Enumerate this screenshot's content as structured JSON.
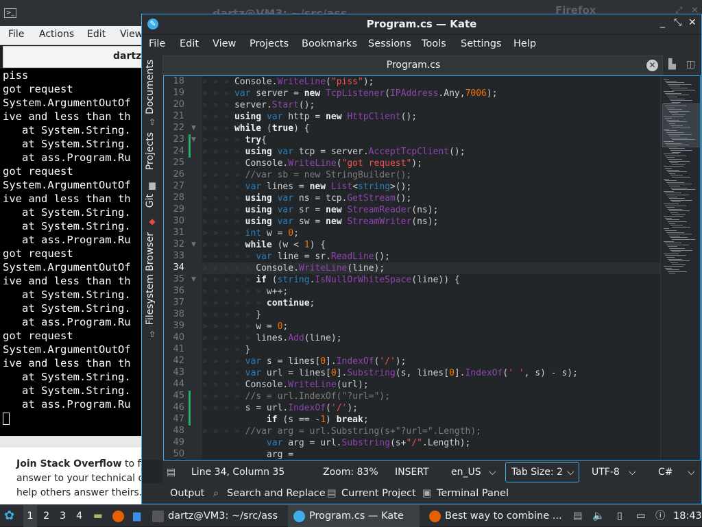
{
  "background_window": {
    "title": "dartz@VM3: ~/src/ass",
    "other_title": "Firefox",
    "menu": [
      "File",
      "Actions",
      "Edit",
      "View"
    ],
    "tab_title": "dartz",
    "terminal_lines": [
      "piss",
      "got request",
      "System.ArgumentOutOf",
      "ive and less than th",
      "   at System.String.",
      "   at System.String.",
      "   at ass.Program.Ru",
      "got request",
      "System.ArgumentOutOf",
      "ive and less than th",
      "   at System.String.",
      "   at System.String.",
      "   at ass.Program.Ru",
      "got request",
      "System.ArgumentOutOf",
      "ive and less than th",
      "   at System.String.",
      "   at System.String.",
      "   at ass.Program.Ru",
      "got request",
      "System.ArgumentOutOf",
      "ive and less than th",
      "   at System.String.",
      "   at System.String.",
      "   at ass.Program.Ru"
    ],
    "stackoverflow": {
      "bold": "Join Stack Overflow",
      "line1": " to fin",
      "line2": "answer to your technical qu",
      "line3": "help others answer theirs."
    }
  },
  "kate": {
    "title": "Program.cs  — Kate",
    "menu": [
      "File",
      "Edit",
      "View",
      "Projects",
      "Bookmarks",
      "Sessions",
      "Tools",
      "Settings",
      "Help"
    ],
    "side_tabs": [
      "Documents",
      "Projects",
      "Git",
      "Filesystem Browser"
    ],
    "tab_name": "Program.cs",
    "current_line": 34,
    "code_lines": [
      {
        "n": 18,
        "d": 3,
        "t": "Console.WriteLine(\"piss\");"
      },
      {
        "n": 19,
        "d": 3,
        "t": "var server = new TcpListener(IPAddress.Any,7006);"
      },
      {
        "n": 20,
        "d": 3,
        "t": "server.Start();"
      },
      {
        "n": 21,
        "d": 3,
        "t": "using var http = new HttpClient();"
      },
      {
        "n": 22,
        "d": 3,
        "t": "while (true) {"
      },
      {
        "n": 23,
        "d": 4,
        "t": "try{"
      },
      {
        "n": 24,
        "d": 4,
        "t": "using var tcp = server.AcceptTcpClient();"
      },
      {
        "n": 25,
        "d": 4,
        "t": "Console.WriteLine(\"got request\");"
      },
      {
        "n": 26,
        "d": 4,
        "t": "//var sb = new StringBuilder();"
      },
      {
        "n": 27,
        "d": 4,
        "t": "var lines = new List<string>();"
      },
      {
        "n": 28,
        "d": 4,
        "t": "using var ns = tcp.GetStream();"
      },
      {
        "n": 29,
        "d": 4,
        "t": "using var sr = new StreamReader(ns);"
      },
      {
        "n": 30,
        "d": 4,
        "t": "using var sw = new StreamWriter(ns);"
      },
      {
        "n": 31,
        "d": 4,
        "t": "int w = 0;"
      },
      {
        "n": 32,
        "d": 4,
        "t": "while (w < 1) {"
      },
      {
        "n": 33,
        "d": 5,
        "t": "var line = sr.ReadLine();"
      },
      {
        "n": 34,
        "d": 5,
        "t": "Console.WriteLine(line);"
      },
      {
        "n": 35,
        "d": 5,
        "t": "if (string.IsNullOrWhiteSpace(line)) {"
      },
      {
        "n": 36,
        "d": 6,
        "t": "w++;"
      },
      {
        "n": 37,
        "d": 6,
        "t": "continue;"
      },
      {
        "n": 38,
        "d": 5,
        "t": "}"
      },
      {
        "n": 39,
        "d": 5,
        "t": "w = 0;"
      },
      {
        "n": 40,
        "d": 5,
        "t": "lines.Add(line);"
      },
      {
        "n": 41,
        "d": 4,
        "t": "}"
      },
      {
        "n": 42,
        "d": 4,
        "t": "var s = lines[0].IndexOf('/');"
      },
      {
        "n": 43,
        "d": 4,
        "t": "var url = lines[0].Substring(s, lines[0].IndexOf(' ', s) - s);"
      },
      {
        "n": 44,
        "d": 4,
        "t": "Console.WriteLine(url);"
      },
      {
        "n": 45,
        "d": 4,
        "t": "//s = url.IndexOf(\"?url=\");"
      },
      {
        "n": 46,
        "d": 4,
        "t": "s = url.IndexOf('/');"
      },
      {
        "n": 47,
        "d": 0,
        "t": "            if (s == -1) break;"
      },
      {
        "n": 48,
        "d": 4,
        "t": "//var arg = url.Substring(s+\"?url=\".Length);"
      },
      {
        "n": 49,
        "d": 0,
        "t": "            var arg = url.Substring(s+\"/\".Length);"
      },
      {
        "n": 50,
        "d": 0,
        "t": "            arg ="
      }
    ],
    "status": {
      "position": "Line 34, Column 35",
      "zoom": "Zoom: 83%",
      "mode": "INSERT",
      "dictionary": "en_US",
      "tab_size": "Tab Size: 2",
      "encoding": "UTF-8",
      "language": "C#"
    },
    "tool_views": [
      "Output",
      "Search and Replace",
      "Current Project",
      "Terminal Panel"
    ]
  },
  "taskbar": {
    "desktops": [
      "1",
      "2",
      "3",
      "4"
    ],
    "tasks": [
      "dartz@VM3: ~/src/ass",
      "Program.cs  — Kate",
      "Best way to combine ..."
    ],
    "clock": "18:43"
  }
}
